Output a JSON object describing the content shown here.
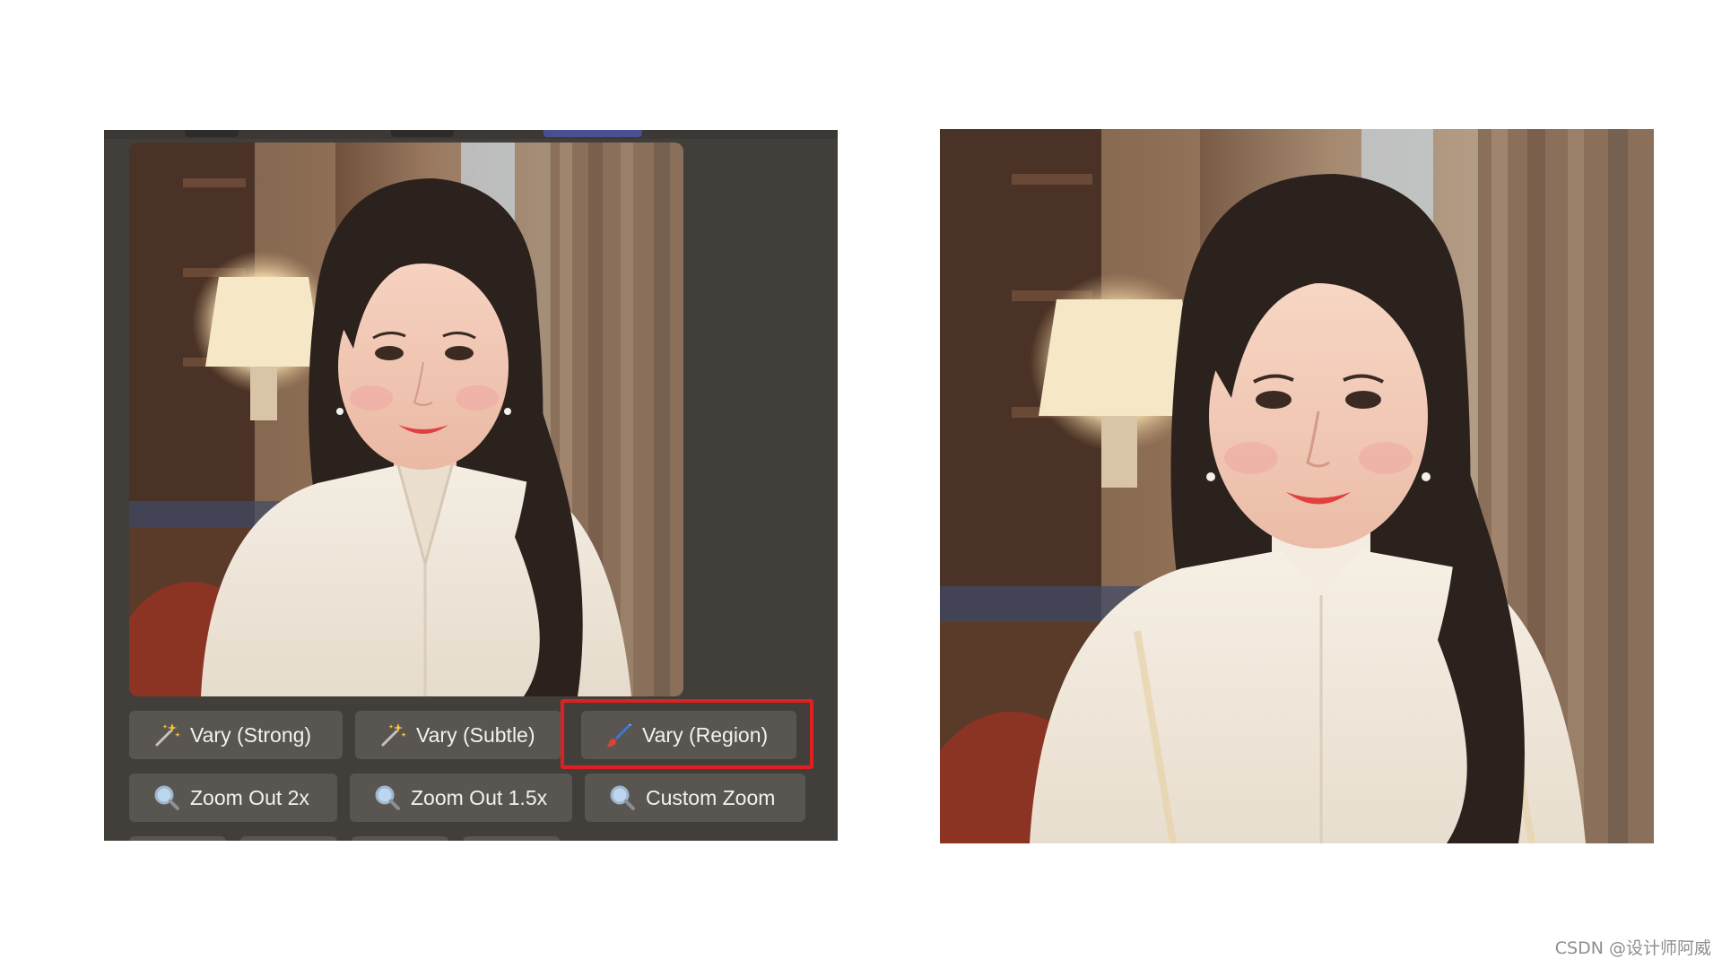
{
  "left_panel": {
    "image": {
      "subject": "generated-portrait-image"
    },
    "buttons_row1": [
      {
        "label": "Vary (Strong)",
        "icon": "magic-wand-icon"
      },
      {
        "label": "Vary (Subtle)",
        "icon": "magic-wand-icon"
      },
      {
        "label": "Vary (Region)",
        "icon": "paintbrush-icon"
      }
    ],
    "buttons_row2": [
      {
        "label": "Zoom Out 2x",
        "icon": "magnifier-icon"
      },
      {
        "label": "Zoom Out 1.5x",
        "icon": "magnifier-icon"
      },
      {
        "label": "Custom Zoom",
        "icon": "magnifier-icon"
      }
    ],
    "highlight_color": "#e02020"
  },
  "colors": {
    "panel_bg": "#423f3b",
    "button_bg": "#595551",
    "button_text": "#f2f2f2"
  },
  "watermark": "CSDN @设计师阿威"
}
